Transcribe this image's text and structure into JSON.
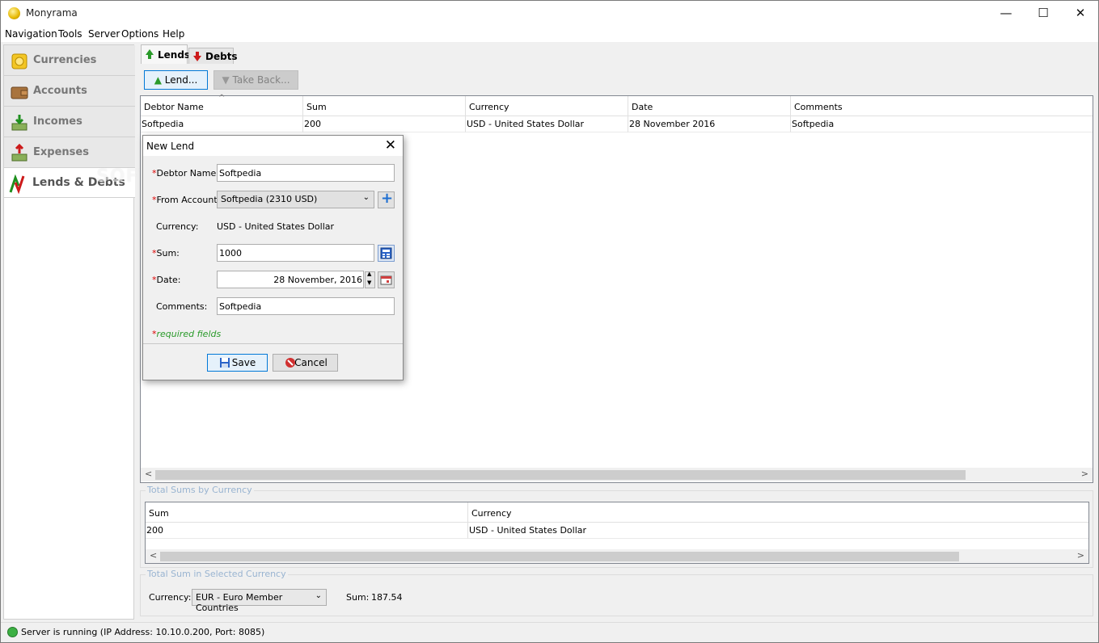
{
  "window": {
    "title": "Monyrama",
    "minimize": "—",
    "maximize": "☐",
    "close": "✕"
  },
  "menu": [
    "Navigation",
    "Tools",
    "Server",
    "Options",
    "Help"
  ],
  "nav": {
    "items": [
      {
        "label": "Currencies",
        "icon": "currencies-icon"
      },
      {
        "label": "Accounts",
        "icon": "wallet-icon"
      },
      {
        "label": "Incomes",
        "icon": "incomes-icon"
      },
      {
        "label": "Expenses",
        "icon": "expenses-icon"
      },
      {
        "label": "Lends & Debts",
        "icon": "lends-debts-icon",
        "selected": true
      }
    ]
  },
  "tabs": [
    {
      "label": "Lends",
      "selected": true
    },
    {
      "label": "Debts"
    }
  ],
  "toolbar": {
    "lend": "Lend...",
    "take_back": "Take Back..."
  },
  "lends_table": {
    "headers": [
      "Debtor Name",
      "Sum",
      "Currency",
      "Date",
      "Comments"
    ],
    "rows": [
      [
        "Softpedia",
        "200",
        "USD - United States Dollar",
        "28 November 2016",
        "Softpedia"
      ]
    ]
  },
  "totals_by_currency": {
    "title": "Total Sums by Currency",
    "headers": [
      "Sum",
      "Currency"
    ],
    "rows": [
      [
        "200",
        "USD - United States Dollar"
      ]
    ]
  },
  "total_selected": {
    "title": "Total Sum in Selected Currency",
    "currency_label": "Currency:",
    "currency_value": "EUR - Euro Member Countries",
    "sum_label": "Sum:",
    "sum_value": "187.54"
  },
  "status": {
    "text": "Server is running (IP Address: 10.10.0.200, Port: 8085)"
  },
  "dialog": {
    "title": "New Lend",
    "debtor_label": "Debtor Name:",
    "debtor_value": "Softpedia",
    "account_label": "From Account:",
    "account_value": "Softpedia (2310 USD)",
    "currency_label": "Currency:",
    "currency_value": "USD - United States Dollar",
    "sum_label": "Sum:",
    "sum_value": "1000",
    "date_label": "Date:",
    "date_value": "28 November, 2016",
    "comments_label": "Comments:",
    "comments_value": "Softpedia",
    "required_note": "required fields",
    "required_mark": "*",
    "save": "Save",
    "cancel": "Cancel"
  },
  "watermark": "SOFTPEDIA",
  "colors": {
    "accent": "#0078d7",
    "required": "#dd0000",
    "required_note": "#2a9a2a",
    "group_title": "#99b4d1"
  }
}
